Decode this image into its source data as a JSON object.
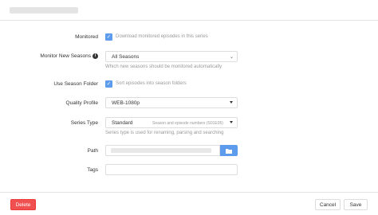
{
  "fields": {
    "monitored": {
      "label": "Monitored",
      "checkbox_text": "Download monitored episodes in this series",
      "checked": true
    },
    "monitor_new_seasons": {
      "label": "Monitor New Seasons",
      "value": "All Seasons",
      "help": "Which new seasons should be monitored automatically"
    },
    "use_season_folder": {
      "label": "Use Season Folder",
      "checkbox_text": "Sort episodes into season folders",
      "checked": true
    },
    "quality_profile": {
      "label": "Quality Profile",
      "value": "WEB-1080p"
    },
    "series_type": {
      "label": "Series Type",
      "value": "Standard",
      "value_hint": "Season and episode numbers (S01E05)",
      "help": "Series type is used for renaming, parsing and searching"
    },
    "path": {
      "label": "Path"
    },
    "tags": {
      "label": "Tags"
    }
  },
  "footer": {
    "delete_label": "Delete",
    "cancel_label": "Cancel",
    "save_label": "Save"
  },
  "icons": {
    "info": "info-icon",
    "check": "check-icon",
    "folder": "folder-icon",
    "caret": "caret-down-icon"
  },
  "colors": {
    "primary": "#5d9cec",
    "danger": "#f05050"
  }
}
